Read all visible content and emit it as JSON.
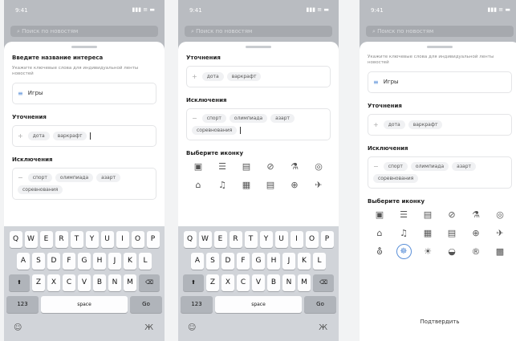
{
  "status_time": "9:41",
  "status_icons": "▮▮▮ ≡ ▬",
  "search_placeholder": "Поиск по новостям",
  "labels": {
    "title": "Введите название интереса",
    "hint": "Укажите ключевые слова для индивидуальной ленты новостей",
    "refinements": "Уточнения",
    "exclusions": "Исключения",
    "choose_icon": "Выберите иконку",
    "confirm": "Подтвердить"
  },
  "interest_value": "Игры",
  "refinement_chips": [
    "дота",
    "варкрафт"
  ],
  "exclusion_chips": [
    "спорт",
    "олимпиада",
    "азарт",
    "соревнования"
  ],
  "icons_row1": [
    "▣",
    "☰",
    "▤",
    "⊘",
    "⚗",
    "◎"
  ],
  "icons_row2": [
    "⌂",
    "♫",
    "▦",
    "▤",
    "⊕",
    "✈"
  ],
  "icons_row3": [
    "⛢",
    "☸",
    "☀",
    "◒",
    "®",
    "▩"
  ],
  "keyboard": {
    "row1": [
      "Q",
      "W",
      "E",
      "R",
      "T",
      "Y",
      "U",
      "I",
      "O",
      "P"
    ],
    "row2": [
      "A",
      "S",
      "D",
      "F",
      "G",
      "H",
      "J",
      "K",
      "L"
    ],
    "row3": [
      "Z",
      "X",
      "C",
      "V",
      "B",
      "N",
      "M"
    ],
    "shift": "⬆",
    "backspace": "⌫",
    "numbers": "123",
    "space": "space",
    "go": "Go",
    "emoji": "☺",
    "mic": "Ж"
  },
  "accent_color": "#5a8fd8"
}
